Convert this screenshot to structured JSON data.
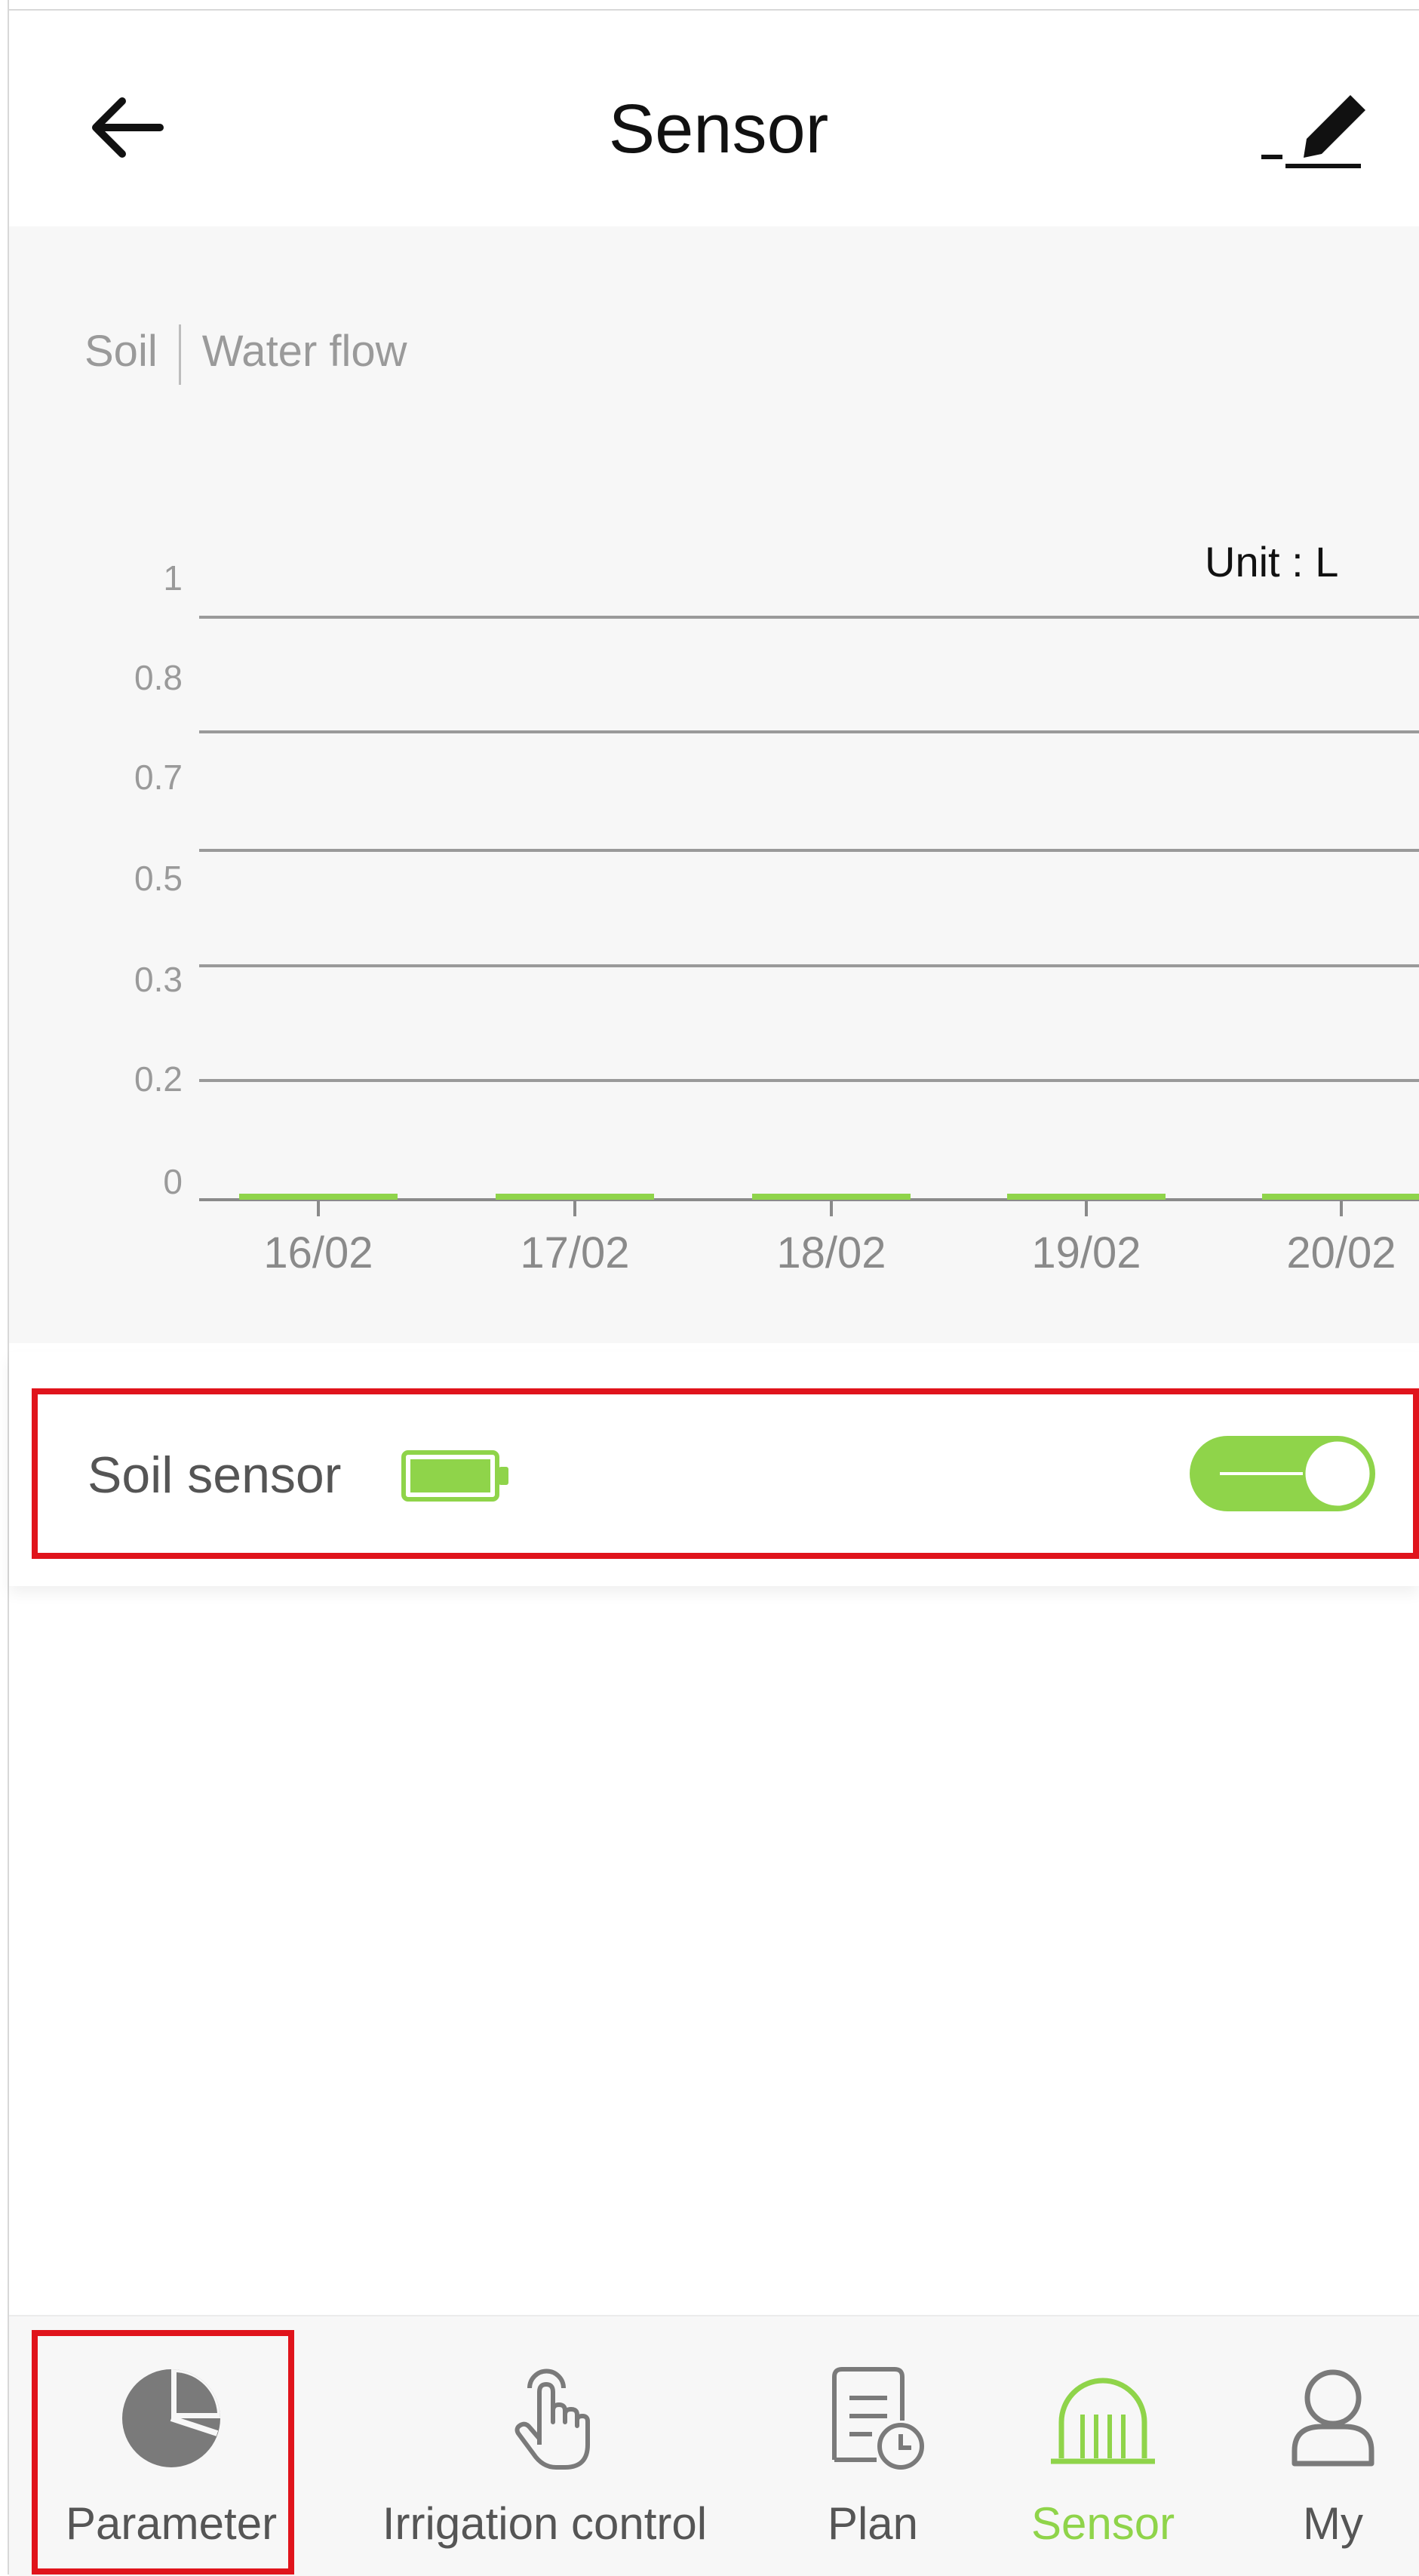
{
  "header": {
    "title": "Sensor",
    "back_icon": "arrow-left-icon",
    "edit_icon": "edit-pen-icon"
  },
  "tabs": [
    "Soil",
    "Water flow"
  ],
  "chart_data": {
    "type": "bar",
    "unit_label": "Unit : L",
    "categories": [
      "16/02",
      "17/02",
      "18/02",
      "19/02",
      "20/02"
    ],
    "values": [
      0,
      0,
      0,
      0,
      0
    ],
    "y_ticks": [
      "1",
      "0.8",
      "0.7",
      "0.5",
      "0.3",
      "0.2",
      "0"
    ],
    "ylim": [
      0,
      1
    ],
    "grid": true,
    "bar_color": "#8fd44a"
  },
  "sensor": {
    "label": "Soil sensor",
    "battery_icon": "battery-full-icon",
    "toggle_on": true
  },
  "colors": {
    "accent": "#8fd44a",
    "highlight": "#e0141c"
  },
  "nav": [
    {
      "label": "Parameter",
      "icon": "pie-chart-icon",
      "active": false
    },
    {
      "label": "Irrigation control",
      "icon": "touch-hand-icon",
      "active": false
    },
    {
      "label": "Plan",
      "icon": "document-clock-icon",
      "active": false
    },
    {
      "label": "Sensor",
      "icon": "sensor-arch-icon",
      "active": true
    },
    {
      "label": "My",
      "icon": "user-icon",
      "active": false
    }
  ]
}
